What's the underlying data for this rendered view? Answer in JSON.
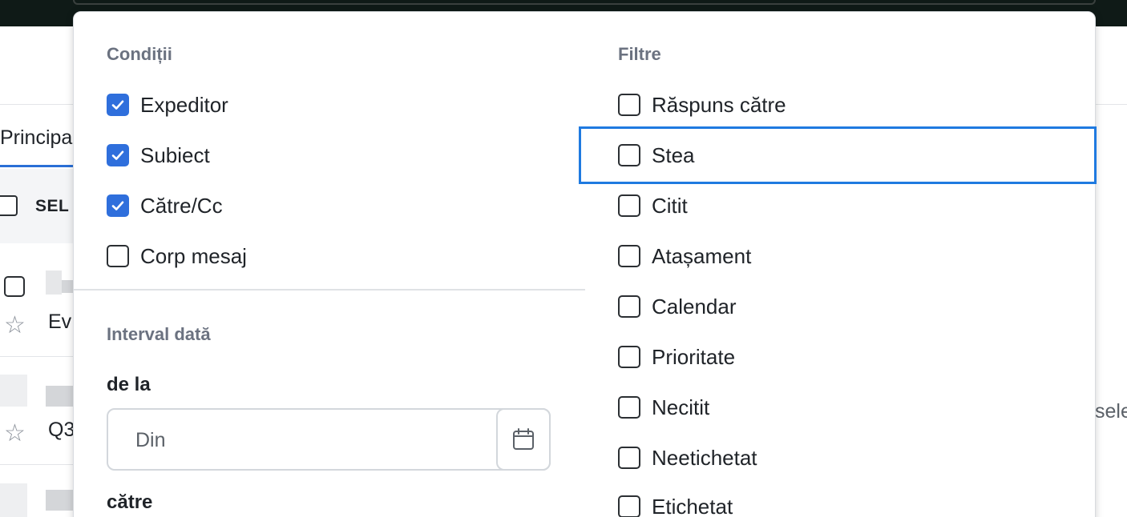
{
  "background": {
    "tab_label": "Principa",
    "select_label": "SEL",
    "rows": [
      {
        "text": "Ev"
      },
      {
        "text": "Q3"
      }
    ],
    "right_text": "sele"
  },
  "conditions": {
    "title": "Condiții",
    "options": [
      {
        "label": "Expeditor",
        "checked": true
      },
      {
        "label": "Subiect",
        "checked": true
      },
      {
        "label": "Către/Cc",
        "checked": true
      },
      {
        "label": "Corp mesaj",
        "checked": false
      }
    ]
  },
  "date_range": {
    "title": "Interval dată",
    "from_label": "de la",
    "from_placeholder": "Din",
    "to_label": "către"
  },
  "filters": {
    "title": "Filtre",
    "options": [
      {
        "label": "Răspuns către",
        "checked": false
      },
      {
        "label": "Stea",
        "checked": false,
        "focused": true
      },
      {
        "label": "Citit",
        "checked": false
      },
      {
        "label": "Atașament",
        "checked": false
      },
      {
        "label": "Calendar",
        "checked": false
      },
      {
        "label": "Prioritate",
        "checked": false
      },
      {
        "label": "Necitit",
        "checked": false
      },
      {
        "label": "Neetichetat",
        "checked": false
      },
      {
        "label": "Etichetat",
        "checked": false
      }
    ]
  },
  "colors": {
    "accent": "#2f6fdc",
    "focus": "#1f7ae0",
    "topbar": "#0f1a17"
  }
}
